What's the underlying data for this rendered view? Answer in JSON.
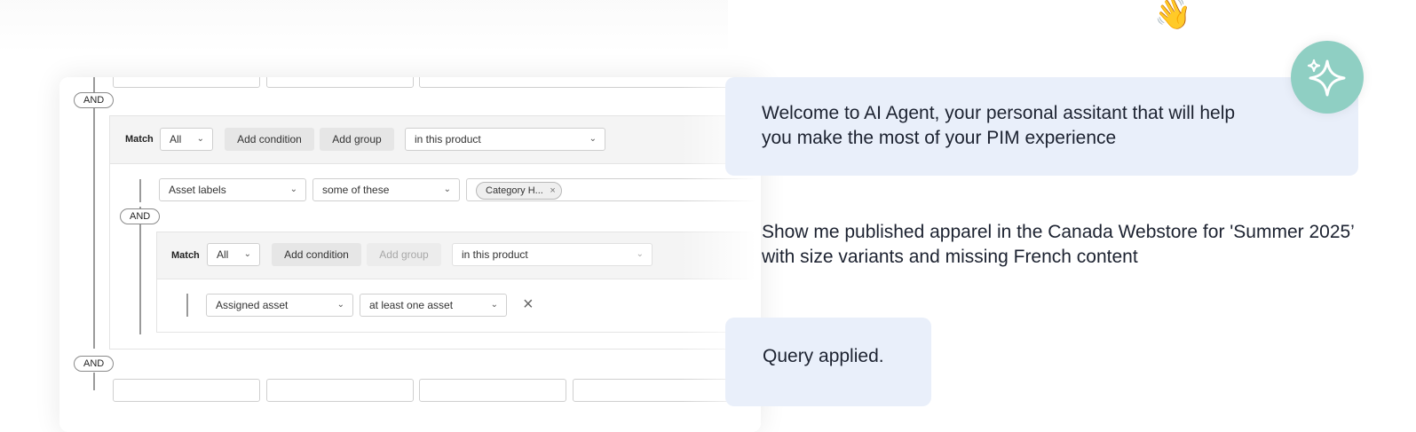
{
  "query_builder": {
    "and_label": "AND",
    "outer_group": {
      "match_label": "Match",
      "match_value": "All",
      "add_condition": "Add condition",
      "add_group": "Add group",
      "scope": "in this product",
      "condition": {
        "field": "Asset labels",
        "operator": "some of these",
        "chip": "Category H...",
        "chip_remove": "×"
      },
      "inner_group": {
        "match_label": "Match",
        "match_value": "All",
        "add_condition": "Add condition",
        "add_group": "Add group",
        "scope": "in this product",
        "condition": {
          "field": "Assigned asset",
          "operator": "at least one asset",
          "remove": "×"
        }
      }
    }
  },
  "chat": {
    "welcome": "Welcome to AI Agent, your personal assitant that will help you make the most of your PIM experience",
    "user_prompt": "Show me published apparel in the Canada Webstore for 'Summer 2025’ with size variants and missing French content",
    "result": "Query applied.",
    "wave_emoji": "👋"
  },
  "colors": {
    "bubble": "#e9effa",
    "ai_badge": "#8fcfc3"
  },
  "icons": {
    "ai_badge": "sparkle-icon",
    "select": "chevron-down-icon"
  }
}
